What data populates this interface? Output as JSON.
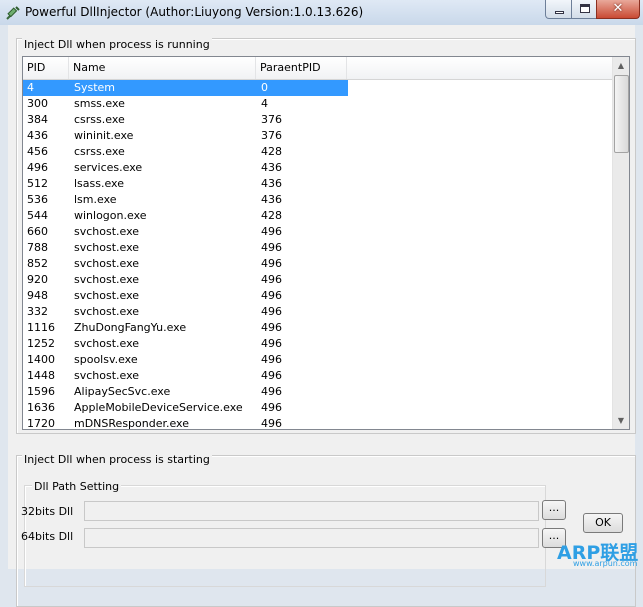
{
  "window": {
    "title": "Powerful DllInjector (Author:Liuyong Version:1.0.13.626)",
    "app_icon": "syringe-icon",
    "controls": [
      "minimize-icon",
      "maximize-icon",
      "close-icon"
    ]
  },
  "running_group": {
    "legend": "Inject Dll when process is running",
    "columns": [
      "PID",
      "Name",
      "ParaentPID"
    ],
    "rows": [
      {
        "pid": "4",
        "name": "System",
        "ppid": "0",
        "selected": true
      },
      {
        "pid": "300",
        "name": "smss.exe",
        "ppid": "4"
      },
      {
        "pid": "384",
        "name": "csrss.exe",
        "ppid": "376"
      },
      {
        "pid": "436",
        "name": "wininit.exe",
        "ppid": "376"
      },
      {
        "pid": "456",
        "name": "csrss.exe",
        "ppid": "428"
      },
      {
        "pid": "496",
        "name": "services.exe",
        "ppid": "436"
      },
      {
        "pid": "512",
        "name": "lsass.exe",
        "ppid": "436"
      },
      {
        "pid": "536",
        "name": "lsm.exe",
        "ppid": "436"
      },
      {
        "pid": "544",
        "name": "winlogon.exe",
        "ppid": "428"
      },
      {
        "pid": "660",
        "name": "svchost.exe",
        "ppid": "496"
      },
      {
        "pid": "788",
        "name": "svchost.exe",
        "ppid": "496"
      },
      {
        "pid": "852",
        "name": "svchost.exe",
        "ppid": "496"
      },
      {
        "pid": "920",
        "name": "svchost.exe",
        "ppid": "496"
      },
      {
        "pid": "948",
        "name": "svchost.exe",
        "ppid": "496"
      },
      {
        "pid": "332",
        "name": "svchost.exe",
        "ppid": "496"
      },
      {
        "pid": "1116",
        "name": "ZhuDongFangYu.exe",
        "ppid": "496"
      },
      {
        "pid": "1252",
        "name": "svchost.exe",
        "ppid": "496"
      },
      {
        "pid": "1400",
        "name": "spoolsv.exe",
        "ppid": "496"
      },
      {
        "pid": "1448",
        "name": "svchost.exe",
        "ppid": "496"
      },
      {
        "pid": "1596",
        "name": "AlipaySecSvc.exe",
        "ppid": "496"
      },
      {
        "pid": "1636",
        "name": "AppleMobileDeviceService.exe",
        "ppid": "496"
      },
      {
        "pid": "1720",
        "name": "mDNSResponder.exe",
        "ppid": "496"
      }
    ]
  },
  "starting_group": {
    "legend": "Inject Dll when process is starting",
    "dll_path_legend": "Dll Path Setting",
    "label_32": "32bits Dll",
    "label_64": "64bits Dll",
    "value_32": "",
    "value_64": "",
    "browse_label": "...",
    "ok_label": "OK"
  },
  "watermark": {
    "main": "ARP联盟",
    "url": "www.arpun.com"
  }
}
